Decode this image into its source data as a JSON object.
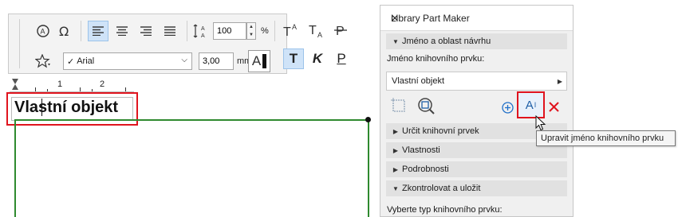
{
  "toolbar": {
    "size_value": "100",
    "size_unit": "%",
    "font_name": "Arial",
    "height_value": "3,00",
    "height_unit": "mm",
    "btn_pen_label": "A",
    "btn_bold_label": "T",
    "btn_italic_label": "K",
    "btn_underline_label": "P"
  },
  "ruler": {
    "tick_1": "1",
    "tick_2": "2"
  },
  "canvas": {
    "text_value": "Vlastní objekt",
    "line_color": "#2f8a2f"
  },
  "palette": {
    "title": "Library Part Maker",
    "close_glyph": "✕",
    "section_name_area": "Jméno a oblast návrhu",
    "label_part_name": "Jméno knihovního prvku:",
    "part_name_value": "Vlastní objekt",
    "section_define": "Určit knihovní prvek",
    "section_properties": "Vlastnosti",
    "section_details": "Podrobnosti",
    "section_check_save": "Zkontrolovat a uložit",
    "label_select_type": "Vyberte typ knihovního prvku:",
    "tooltip": "Upravit jméno knihovního prvku",
    "edit_btn_label": "A",
    "edit_btn_sup": "I",
    "accent_color": "#1f5fa6",
    "highlight_color": "#e0141e"
  }
}
